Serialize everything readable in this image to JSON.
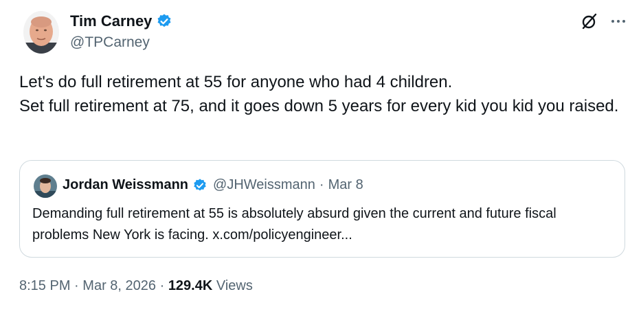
{
  "author": {
    "name": "Tim Carney",
    "handle": "@TPCarney",
    "verified": true,
    "avatar_icon": "person-avatar"
  },
  "top_actions": {
    "grok_icon": "grok-slash-circle-icon",
    "more_icon": "more-horizontal-icon"
  },
  "tweet": {
    "lines": [
      "Let's do full retirement at 55 for anyone who had 4 children.",
      "Set full retirement at 75, and it goes down 5 years for every kid you kid you raised."
    ]
  },
  "quote": {
    "name": "Jordan Weissmann",
    "handle": "@JHWeissmann",
    "separator": "·",
    "date": "Mar 8",
    "verified": true,
    "text": "Demanding full retirement at 55 is absolutely absurd given the current and future fiscal problems New York is facing. x.com/policyengineer..."
  },
  "meta": {
    "time": "8:15 PM",
    "separator": "·",
    "date": "Mar 8, 2026",
    "separator2": "·",
    "views_count": "129.4K",
    "views_label": "Views"
  },
  "colors": {
    "verified_blue": "#1d9bf0",
    "secondary_text": "#536471",
    "primary_text": "#0f1419",
    "border": "#cfd9de"
  }
}
